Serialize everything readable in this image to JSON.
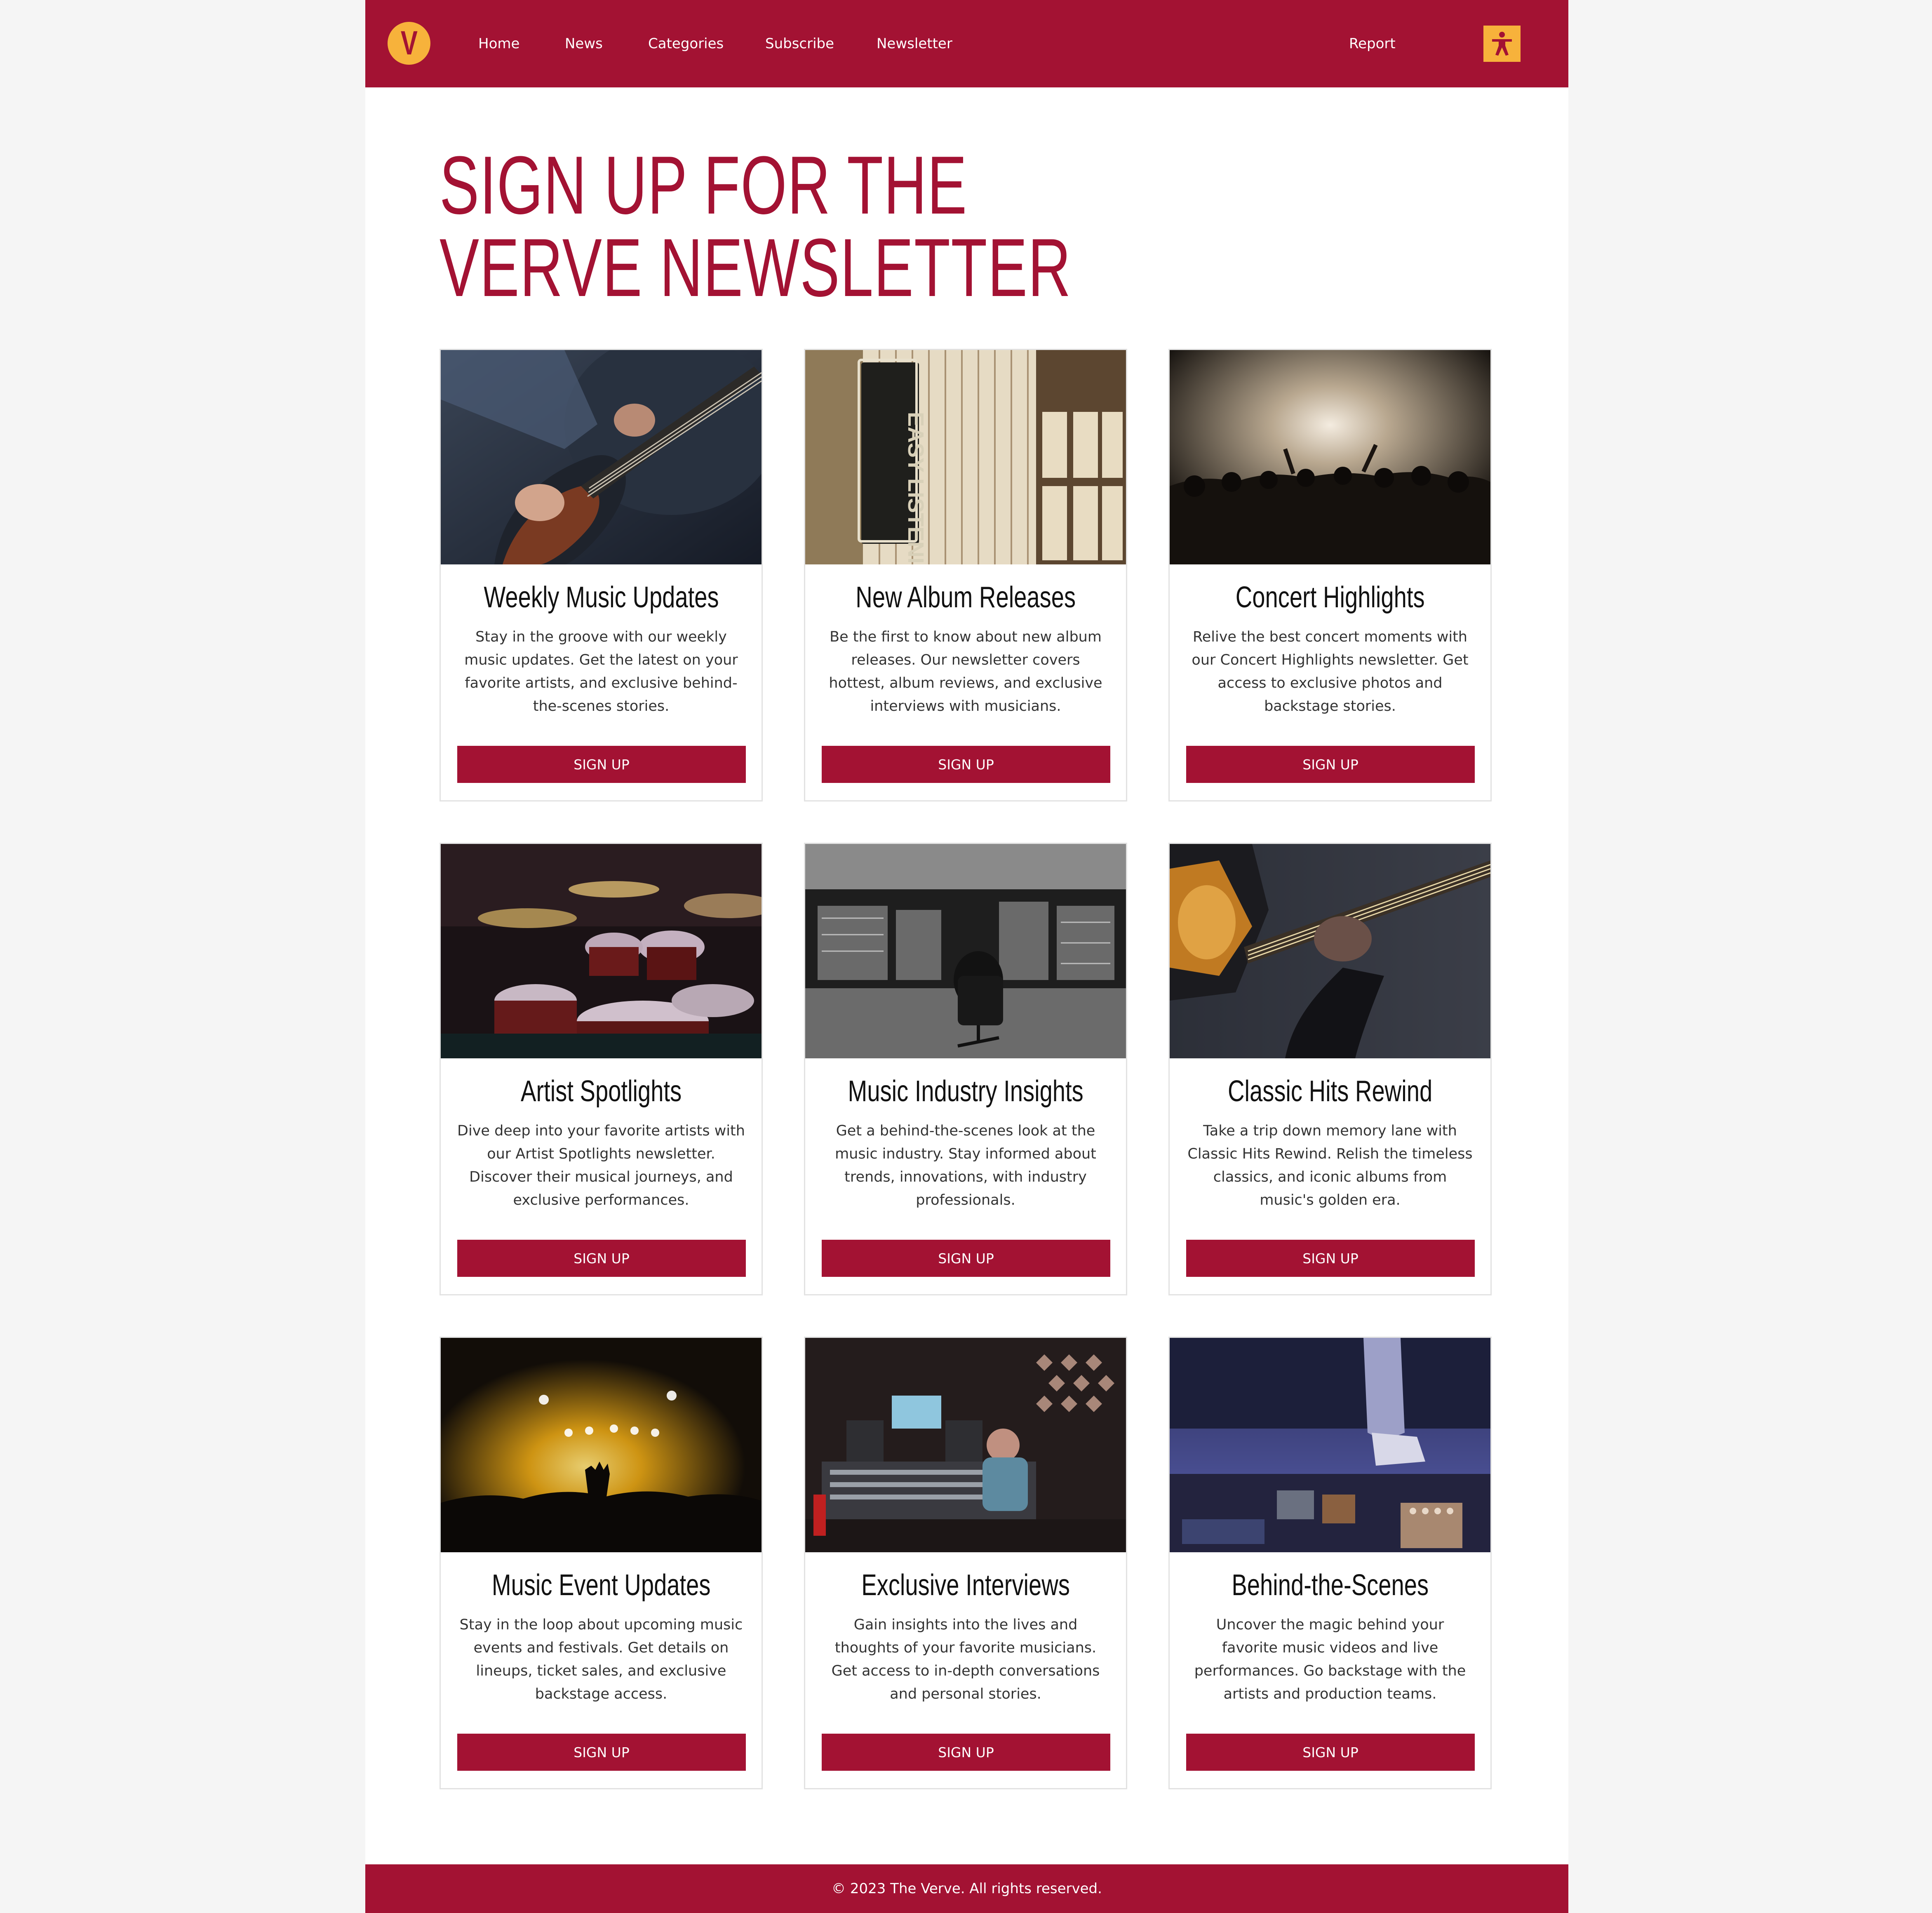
{
  "brand": {
    "logo_letter": "V",
    "primary_color": "#a31233",
    "accent_color": "#f7b23b"
  },
  "nav": {
    "items": [
      {
        "label": "Home"
      },
      {
        "label": "News"
      },
      {
        "label": "Categories"
      },
      {
        "label": "Subscribe"
      },
      {
        "label": "Newsletter"
      }
    ],
    "report_label": "Report",
    "accessibility_icon": "accessibility-icon"
  },
  "main": {
    "title": "SIGN UP FOR THE VERVE NEWSLETTER"
  },
  "cards": [
    {
      "title": "Weekly Music Updates",
      "description": "Stay in the groove with our weekly music updates. Get the latest on your favorite artists, and exclusive behind-the-scenes stories.",
      "button": "SIGN UP",
      "image": "guitarist-photo"
    },
    {
      "title": "New Album Releases",
      "description": "Be the first to know about new album releases. Our newsletter covers hottest, album reviews, and exclusive interviews with musicians.",
      "button": "SIGN UP",
      "image": "record-store-photo",
      "image_sign_text": "EASY LISTENING"
    },
    {
      "title": "Concert Highlights",
      "description": "Relive the best concert moments with our Concert Highlights newsletter. Get access to exclusive photos and backstage stories.",
      "button": "SIGN UP",
      "image": "concert-crowd-photo"
    },
    {
      "title": "Artist Spotlights",
      "description": "Dive deep into your favorite artists with our Artist Spotlights newsletter. Discover their musical journeys, and exclusive performances.",
      "button": "SIGN UP",
      "image": "drum-kit-photo"
    },
    {
      "title": "Music Industry Insights",
      "description": "Get a behind-the-scenes look at the music industry. Stay informed about trends, innovations, with industry professionals.",
      "button": "SIGN UP",
      "image": "studio-console-photo"
    },
    {
      "title": "Classic Hits Rewind",
      "description": "Take a trip down memory lane with Classic Hits Rewind. Relish the timeless classics, and iconic albums from music's golden era.",
      "button": "SIGN UP",
      "image": "bass-guitar-photo"
    },
    {
      "title": "Music Event Updates",
      "description": "Stay in the loop about upcoming music events and festivals. Get details on lineups, ticket sales, and exclusive backstage access.",
      "button": "SIGN UP",
      "image": "festival-lights-photo"
    },
    {
      "title": "Exclusive Interviews",
      "description": "Gain insights into the lives and thoughts of your favorite musicians. Get access to in-depth conversations and personal stories.",
      "button": "SIGN UP",
      "image": "recording-studio-photo"
    },
    {
      "title": "Behind-the-Scenes",
      "description": "Uncover the magic behind your favorite music videos and live performances. Go backstage with the artists and production teams.",
      "button": "SIGN UP",
      "image": "stage-pedals-photo"
    }
  ],
  "footer": {
    "text": "© 2023 The Verve. All rights reserved."
  }
}
